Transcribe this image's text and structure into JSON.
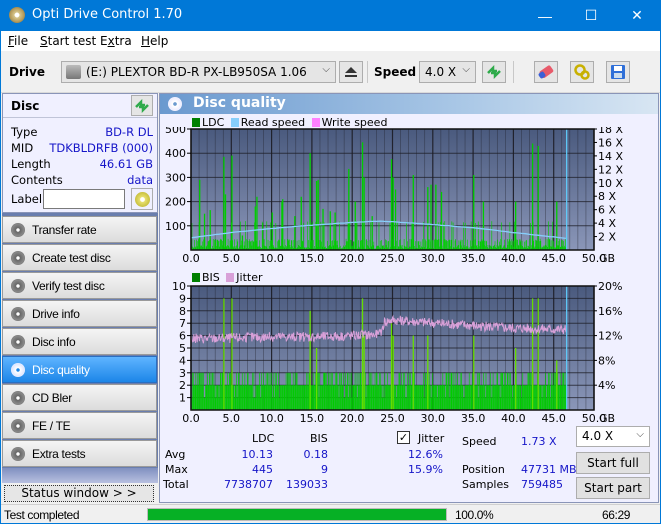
{
  "window": {
    "title": "Opti Drive Control 1.70",
    "controls": {
      "minimize": "—",
      "maximize": "☐",
      "close": "✕"
    }
  },
  "menu": [
    {
      "label": "File",
      "accel": "F",
      "rest": "ile"
    },
    {
      "label": "Start test",
      "accel": "S",
      "rest": "tart test"
    },
    {
      "label": "Extra",
      "accel": "x",
      "pre": "E",
      "rest": "tra"
    },
    {
      "label": "Help",
      "accel": "H",
      "rest": "elp"
    }
  ],
  "toolbar": {
    "drive_label": "Drive",
    "drive_value": "(E:)  PLEXTOR BD-R  PX-LB950SA 1.06",
    "speed_label": "Speed",
    "speed_value": "4.0 X",
    "icons": [
      "eject-icon",
      "refresh-icon",
      "erase-icon",
      "settings-icon",
      "save-icon"
    ]
  },
  "disc": {
    "header": "Disc",
    "rows": [
      {
        "key": "Type",
        "value": "BD-R DL"
      },
      {
        "key": "MID",
        "value": "TDKBLDRFB (000)"
      },
      {
        "key": "Length",
        "value": "46.61 GB"
      },
      {
        "key": "Contents",
        "value": "data"
      }
    ],
    "label_key": "Label",
    "label_value": ""
  },
  "nav": [
    {
      "label": "Transfer rate",
      "active": false
    },
    {
      "label": "Create test disc",
      "active": false
    },
    {
      "label": "Verify test disc",
      "active": false
    },
    {
      "label": "Drive info",
      "active": false
    },
    {
      "label": "Disc info",
      "active": false
    },
    {
      "label": "Disc quality",
      "active": true
    },
    {
      "label": "CD Bler",
      "active": false
    },
    {
      "label": "FE / TE",
      "active": false
    },
    {
      "label": "Extra tests",
      "active": false
    }
  ],
  "status_window_label": "Status window > >",
  "panel": {
    "title": "Disc quality",
    "legend_top": [
      {
        "label": "LDC",
        "color": "#008000"
      },
      {
        "label": "Read speed",
        "color": "#87cefa"
      },
      {
        "label": "Write speed",
        "color": "#ff80ff"
      }
    ],
    "legend_bottom": [
      {
        "label": "BIS",
        "color": "#008000"
      },
      {
        "label": "Jitter",
        "color": "#d8a0d8"
      }
    ]
  },
  "chart_data": [
    {
      "type": "bar",
      "title": "LDC / Read speed",
      "xlabel": "GB",
      "x_ticks": [
        "0.0",
        "5.0",
        "10.0",
        "15.0",
        "20.0",
        "25.0",
        "30.0",
        "35.0",
        "40.0",
        "45.0",
        "50.0"
      ],
      "xlim": [
        0,
        50
      ],
      "ylim": [
        0,
        500
      ],
      "y_ticks": [
        "100",
        "200",
        "300",
        "400",
        "500"
      ],
      "y2lim": [
        0,
        18
      ],
      "y2_ticks": [
        "2 X",
        "4 X",
        "6 X",
        "8 X",
        "10 X",
        "12 X",
        "14 X",
        "16 X",
        "18 X"
      ],
      "disc_end_gb": 46.61,
      "series": [
        {
          "name": "LDC",
          "color": "#00cc00",
          "baseline": 20,
          "spikes": [
            [
              1.0,
              290
            ],
            [
              1.6,
              150
            ],
            [
              2.3,
              165
            ],
            [
              4.0,
              385
            ],
            [
              4.2,
              230
            ],
            [
              5.0,
              390
            ],
            [
              6.3,
              60
            ],
            [
              7.9,
              180
            ],
            [
              8.1,
              220
            ],
            [
              10.0,
              155
            ],
            [
              11.2,
              200
            ],
            [
              11.3,
              210
            ],
            [
              12.8,
              140
            ],
            [
              13.6,
              220
            ],
            [
              14.7,
              400
            ],
            [
              15.5,
              285
            ],
            [
              15.7,
              290
            ],
            [
              16.3,
              170
            ],
            [
              17.2,
              160
            ],
            [
              17.8,
              155
            ],
            [
              19.5,
              335
            ],
            [
              20.3,
              200
            ],
            [
              21.2,
              445
            ],
            [
              21.4,
              300
            ],
            [
              22.4,
              140
            ],
            [
              24.8,
              375
            ],
            [
              25.0,
              300
            ],
            [
              25.3,
              250
            ],
            [
              27.5,
              310
            ],
            [
              29.3,
              260
            ],
            [
              29.7,
              270
            ],
            [
              30.3,
              270
            ],
            [
              31.0,
              240
            ],
            [
              35.0,
              310
            ],
            [
              36.2,
              200
            ],
            [
              40.2,
              200
            ],
            [
              42.3,
              440
            ],
            [
              43.0,
              430
            ],
            [
              45.3,
              200
            ]
          ]
        },
        {
          "name": "Read speed",
          "color": "#87cefa",
          "unit": "X",
          "points": [
            [
              0,
              1.8
            ],
            [
              5,
              2.6
            ],
            [
              10,
              3.2
            ],
            [
              15,
              3.7
            ],
            [
              20,
              4.1
            ],
            [
              23.5,
              4.3
            ],
            [
              25,
              4.2
            ],
            [
              30,
              3.8
            ],
            [
              35,
              3.3
            ],
            [
              40,
              2.6
            ],
            [
              46.6,
              1.73
            ]
          ]
        }
      ]
    },
    {
      "type": "bar",
      "title": "BIS / Jitter",
      "xlabel": "GB",
      "x_ticks": [
        "0.0",
        "5.0",
        "10.0",
        "15.0",
        "20.0",
        "25.0",
        "30.0",
        "35.0",
        "40.0",
        "45.0",
        "50.0"
      ],
      "xlim": [
        0,
        50
      ],
      "ylim": [
        0,
        10
      ],
      "y_ticks": [
        "1",
        "2",
        "3",
        "4",
        "5",
        "6",
        "7",
        "8",
        "9",
        "10"
      ],
      "y2lim": [
        0,
        20
      ],
      "y2_ticks": [
        "4%",
        "8%",
        "12%",
        "16%",
        "20%"
      ],
      "disc_end_gb": 46.61,
      "series": [
        {
          "name": "BIS",
          "color": "#00cc00",
          "baseline": 2,
          "spikes": [
            [
              4.0,
              9
            ],
            [
              5.0,
              9
            ],
            [
              14.7,
              8
            ],
            [
              15.5,
              5
            ],
            [
              21.2,
              9
            ],
            [
              21.4,
              6
            ],
            [
              24.8,
              7
            ],
            [
              25.0,
              6
            ],
            [
              27.5,
              6
            ],
            [
              29.3,
              6
            ],
            [
              35.0,
              6
            ],
            [
              40.2,
              5
            ],
            [
              42.3,
              9
            ],
            [
              43.0,
              9
            ],
            [
              45.3,
              4
            ]
          ]
        },
        {
          "name": "Jitter",
          "color": "#d8a0d8",
          "unit": "%",
          "points": [
            [
              0,
              11.5
            ],
            [
              5,
              11.6
            ],
            [
              10,
              11.8
            ],
            [
              15,
              11.8
            ],
            [
              20,
              12.0
            ],
            [
              23.5,
              12.2
            ],
            [
              24,
              14.2
            ],
            [
              25,
              14.5
            ],
            [
              30,
              14.0
            ],
            [
              35,
              13.6
            ],
            [
              40,
              13.2
            ],
            [
              45,
              13.0
            ],
            [
              46.6,
              13.0
            ]
          ]
        }
      ]
    }
  ],
  "stats": {
    "col_ldc": "LDC",
    "col_bis": "BIS",
    "jitter_label": "Jitter",
    "jitter_checked": true,
    "rows": [
      {
        "label": "Avg",
        "ldc": "10.13",
        "bis": "0.18",
        "jitter": "12.6%"
      },
      {
        "label": "Max",
        "ldc": "445",
        "bis": "9",
        "jitter": "15.9%"
      },
      {
        "label": "Total",
        "ldc": "7738707",
        "bis": "139033",
        "jitter": ""
      }
    ],
    "speed_label": "Speed",
    "speed_value": "1.73 X",
    "position_label": "Position",
    "position_value": "47731 MB",
    "samples_label": "Samples",
    "samples_value": "759485",
    "speed_select": "4.0 X",
    "start_full": "Start full",
    "start_part": "Start part"
  },
  "statusbar": {
    "text": "Test completed",
    "progress_percent": 100,
    "progress_label": "100.0%",
    "elapsed": "66:29"
  }
}
